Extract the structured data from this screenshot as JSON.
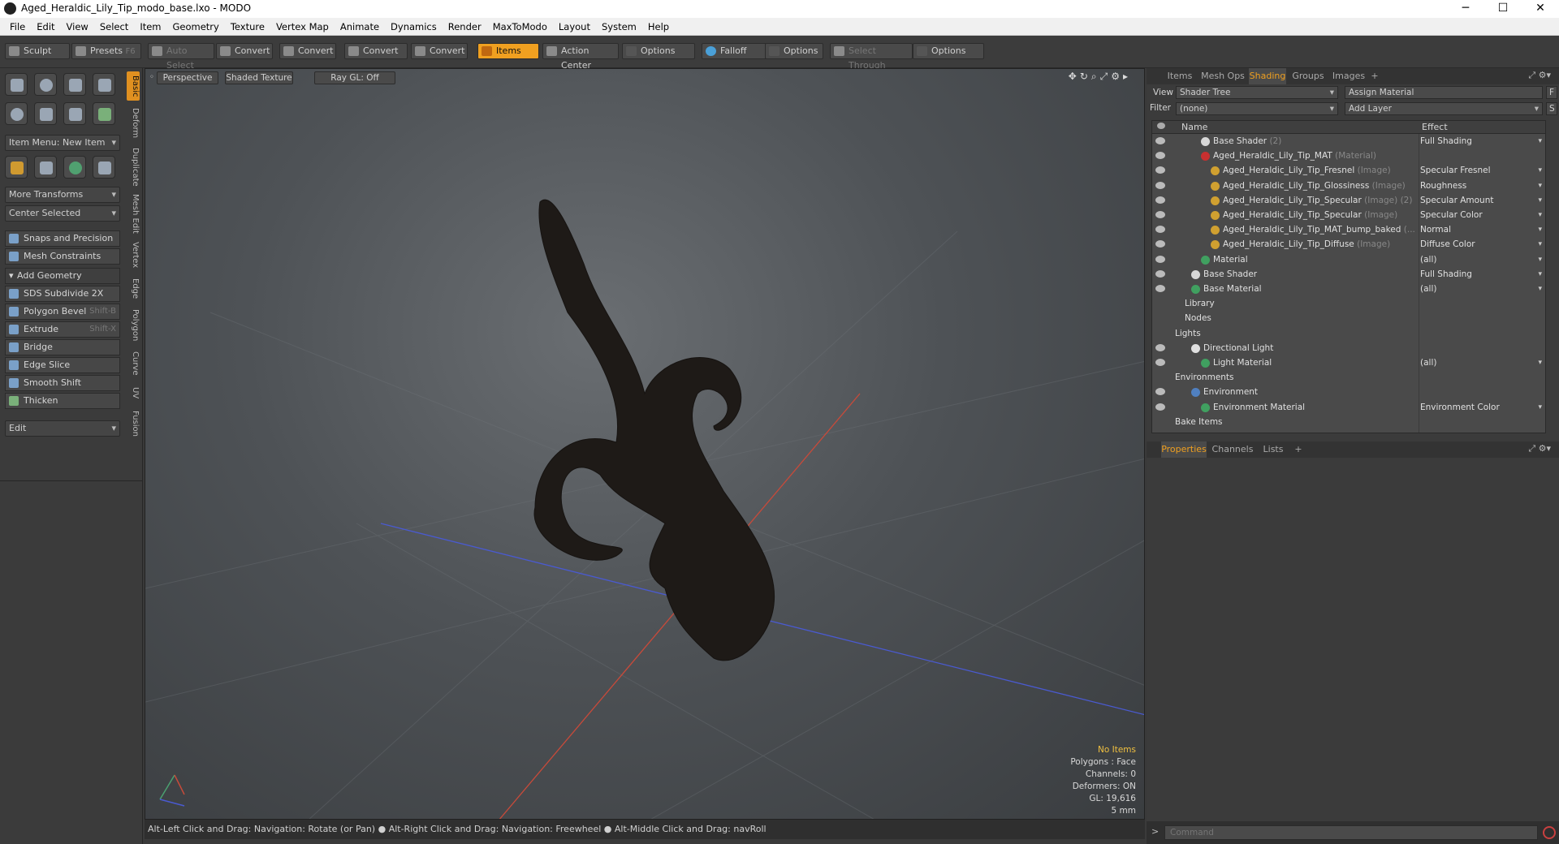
{
  "window": {
    "title": "Aged_Heraldic_Lily_Tip_modo_base.lxo - MODO"
  },
  "menu": [
    "File",
    "Edit",
    "View",
    "Select",
    "Item",
    "Geometry",
    "Texture",
    "Vertex Map",
    "Animate",
    "Dynamics",
    "Render",
    "MaxToModo",
    "Layout",
    "System",
    "Help"
  ],
  "toolbar": {
    "sculpt": "Sculpt",
    "presets": "Presets",
    "presets_key": "F6",
    "auto_select": "Auto Select",
    "convert1": "Convert",
    "convert2": "Convert",
    "convert3": "Convert",
    "convert4": "Convert",
    "items": "Items",
    "action_center": "Action Center",
    "options1": "Options",
    "falloff": "Falloff",
    "options2": "Options",
    "select_through": "Select Through",
    "options3": "Options"
  },
  "left": {
    "item_menu": "Item Menu: New Item",
    "more_transforms": "More Transforms",
    "center_selected": "Center Selected",
    "snaps": "Snaps and Precision",
    "mesh_constraints": "Mesh Constraints",
    "add_geometry": "Add Geometry",
    "sds": "SDS Subdivide 2X",
    "bevel": "Polygon Bevel",
    "bevel_key": "Shift-B",
    "extrude": "Extrude",
    "extrude_key": "Shift-X",
    "bridge": "Bridge",
    "edge_slice": "Edge Slice",
    "smooth_shift": "Smooth Shift",
    "thicken": "Thicken",
    "edit": "Edit",
    "vtabs": [
      "Basic",
      "Deform",
      "Duplicate",
      "Mesh Edit",
      "Vertex",
      "Edge",
      "Polygon",
      "Curve",
      "UV",
      "Fusion"
    ]
  },
  "viewport": {
    "perspective": "Perspective",
    "shading": "Shaded Texture",
    "raygl": "Ray GL: Off",
    "hud": {
      "items": "No Items",
      "polygons": "Polygons : Face",
      "channels": "Channels: 0",
      "deformers": "Deformers: ON",
      "gl": "GL: 19,616",
      "unit": "5 mm"
    }
  },
  "status": "Alt-Left Click and Drag: Navigation: Rotate (or Pan) ● Alt-Right Click and Drag: Navigation: Freewheel ● Alt-Middle Click and Drag: navRoll",
  "right": {
    "tabs": [
      "Items",
      "Mesh Ops",
      "Shading",
      "Groups",
      "Images",
      "+"
    ],
    "view_label": "View",
    "view_value": "Shader Tree",
    "assign": "Assign Material",
    "f": "F",
    "filter_label": "Filter",
    "filter_value": "(none)",
    "add_layer": "Add Layer",
    "s": "S",
    "col_name": "Name",
    "col_effect": "Effect",
    "rows": [
      {
        "name": "Base Shader",
        "type": "(2)",
        "effect": "Full Shading",
        "indent": 60,
        "color": "#d8d8d8"
      },
      {
        "name": "Aged_Heraldic_Lily_Tip_MAT",
        "type": "(Material)",
        "effect": "",
        "indent": 60,
        "color": "#c83030"
      },
      {
        "name": "Aged_Heraldic_Lily_Tip_Fresnel",
        "type": "(Image)",
        "effect": "Specular Fresnel",
        "indent": 72,
        "color": "#d0a030"
      },
      {
        "name": "Aged_Heraldic_Lily_Tip_Glossiness",
        "type": "(Image)",
        "effect": "Roughness",
        "indent": 72,
        "color": "#d0a030"
      },
      {
        "name": "Aged_Heraldic_Lily_Tip_Specular",
        "type": "(Image) (2)",
        "effect": "Specular Amount",
        "indent": 72,
        "color": "#d0a030"
      },
      {
        "name": "Aged_Heraldic_Lily_Tip_Specular",
        "type": "(Image)",
        "effect": "Specular Color",
        "indent": 72,
        "color": "#d0a030"
      },
      {
        "name": "Aged_Heraldic_Lily_Tip_MAT_bump_baked",
        "type": "(...",
        "effect": "Normal",
        "indent": 72,
        "color": "#d0a030"
      },
      {
        "name": "Aged_Heraldic_Lily_Tip_Diffuse",
        "type": "(Image)",
        "effect": "Diffuse Color",
        "indent": 72,
        "color": "#d0a030"
      },
      {
        "name": "Material",
        "type": "",
        "effect": "(all)",
        "indent": 60,
        "color": "#40a060"
      },
      {
        "name": "Base Shader",
        "type": "",
        "effect": "Full Shading",
        "indent": 48,
        "color": "#d8d8d8"
      },
      {
        "name": "Base Material",
        "type": "",
        "effect": "(all)",
        "indent": 48,
        "color": "#40a060"
      },
      {
        "name": "Library",
        "type": "",
        "effect": "",
        "indent": 40,
        "color": ""
      },
      {
        "name": "Nodes",
        "type": "",
        "effect": "",
        "indent": 40,
        "color": ""
      },
      {
        "name": "Lights",
        "type": "",
        "effect": "",
        "indent": 28,
        "color": ""
      },
      {
        "name": "Directional Light",
        "type": "",
        "effect": "",
        "indent": 48,
        "color": "#e0e0e0"
      },
      {
        "name": "Light Material",
        "type": "",
        "effect": "(all)",
        "indent": 60,
        "color": "#40a060"
      },
      {
        "name": "Environments",
        "type": "",
        "effect": "",
        "indent": 28,
        "color": ""
      },
      {
        "name": "Environment",
        "type": "",
        "effect": "",
        "indent": 48,
        "color": "#5080c0"
      },
      {
        "name": "Environment Material",
        "type": "",
        "effect": "Environment Color",
        "indent": 60,
        "color": "#40a060"
      },
      {
        "name": "Bake Items",
        "type": "",
        "effect": "",
        "indent": 28,
        "color": ""
      }
    ],
    "prop_tabs": [
      "Properties",
      "Channels",
      "Lists",
      "+"
    ],
    "command_placeholder": "Command"
  }
}
